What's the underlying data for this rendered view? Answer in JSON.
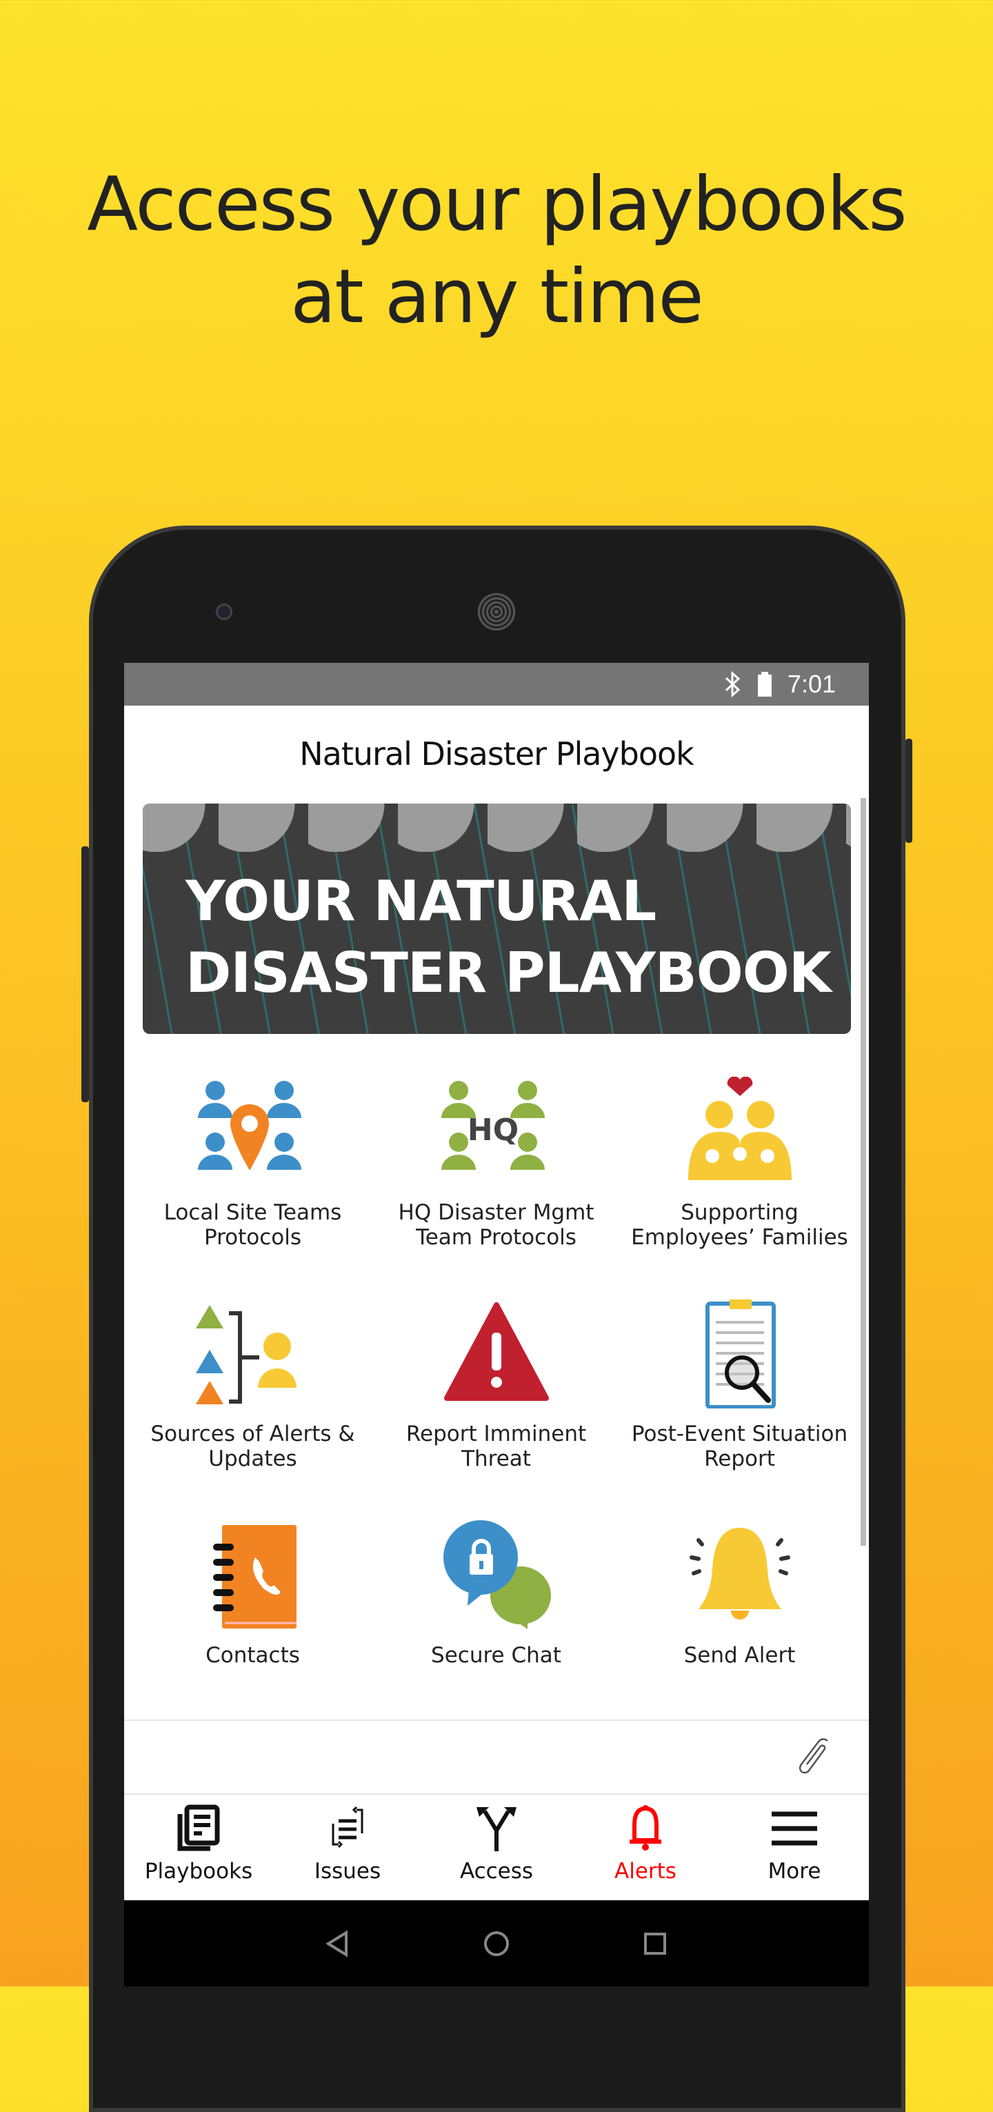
{
  "headline": {
    "line1": "Access your playbooks",
    "line2": "at any time"
  },
  "status_bar": {
    "time": "7:01",
    "icons": [
      "bluetooth-icon",
      "battery-icon"
    ]
  },
  "app": {
    "title": "Natural Disaster Playbook",
    "banner": {
      "line1": "YOUR NATURAL",
      "line2": "DISASTER PLAYBOOK"
    },
    "tiles": [
      {
        "label": "Local Site Teams Protocols",
        "icon": "team-location-icon"
      },
      {
        "label": "HQ Disaster Mgmt Team Protocols",
        "icon": "hq-team-icon",
        "icon_text": "HQ"
      },
      {
        "label": "Supporting Employees’ Families",
        "icon": "family-heart-icon"
      },
      {
        "label": "Sources of Alerts & Updates",
        "icon": "alert-sources-icon"
      },
      {
        "label": "Report Imminent Threat",
        "icon": "warning-icon"
      },
      {
        "label": "Post-Event Situation Report",
        "icon": "report-search-icon"
      },
      {
        "label": "Contacts",
        "icon": "contacts-book-icon"
      },
      {
        "label": "Secure Chat",
        "icon": "secure-chat-icon"
      },
      {
        "label": "Send Alert",
        "icon": "bell-icon"
      }
    ],
    "attach_icon": "paperclip-icon",
    "nav": [
      {
        "label": "Playbooks",
        "icon": "playbooks-icon"
      },
      {
        "label": "Issues",
        "icon": "issues-icon"
      },
      {
        "label": "Access",
        "icon": "access-icon"
      },
      {
        "label": "Alerts",
        "icon": "bell-icon",
        "active": true
      },
      {
        "label": "More",
        "icon": "menu-icon"
      }
    ]
  },
  "colors": {
    "active_nav": "#ff0000",
    "blue": "#3d8fc9",
    "green": "#8fb043",
    "yellow": "#f7c934",
    "red": "#c1202e",
    "orange": "#f28322"
  }
}
